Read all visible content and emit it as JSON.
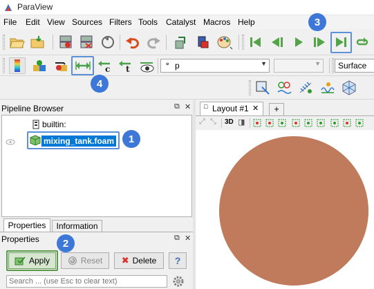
{
  "app": {
    "title": "ParaView"
  },
  "menu": [
    "File",
    "Edit",
    "View",
    "Sources",
    "Filters",
    "Tools",
    "Catalyst",
    "Macros",
    "Help"
  ],
  "toolbar2": {
    "variable_value": "p",
    "representation_value": "Surface"
  },
  "pipeline": {
    "title": "Pipeline Browser",
    "builtin_label": "builtin:",
    "source_label": "mixing_tank.foam"
  },
  "tabs": [
    "Properties",
    "Information"
  ],
  "properties": {
    "title": "Properties",
    "apply_label": "Apply",
    "reset_label": "Reset",
    "delete_label": "Delete",
    "help_label": "?",
    "search_placeholder": "Search ... (use Esc to clear text)"
  },
  "layout": {
    "tab_label": "Layout #1",
    "close_glyph": "✕",
    "add_glyph": "+",
    "view_3d_label": "3D"
  },
  "annotations": [
    "1",
    "2",
    "3",
    "4"
  ],
  "colors": {
    "highlight": "#5b8fd9",
    "badge": "#3d78d8",
    "sphere": "#c07a5c",
    "selection": "#0078d7"
  },
  "icons": [
    "paraview-logo-icon",
    "open-folder-icon",
    "save-state-icon",
    "connect-icon",
    "disconnect-icon",
    "reset-session-icon",
    "undo-icon",
    "redo-icon",
    "camera-icon",
    "color-palette-icon",
    "first-frame-icon",
    "previous-frame-icon",
    "play-icon",
    "next-frame-icon",
    "last-frame-icon",
    "loop-icon",
    "rescale-data-range-icon",
    "cube-axes-icon",
    "eye-icon"
  ]
}
